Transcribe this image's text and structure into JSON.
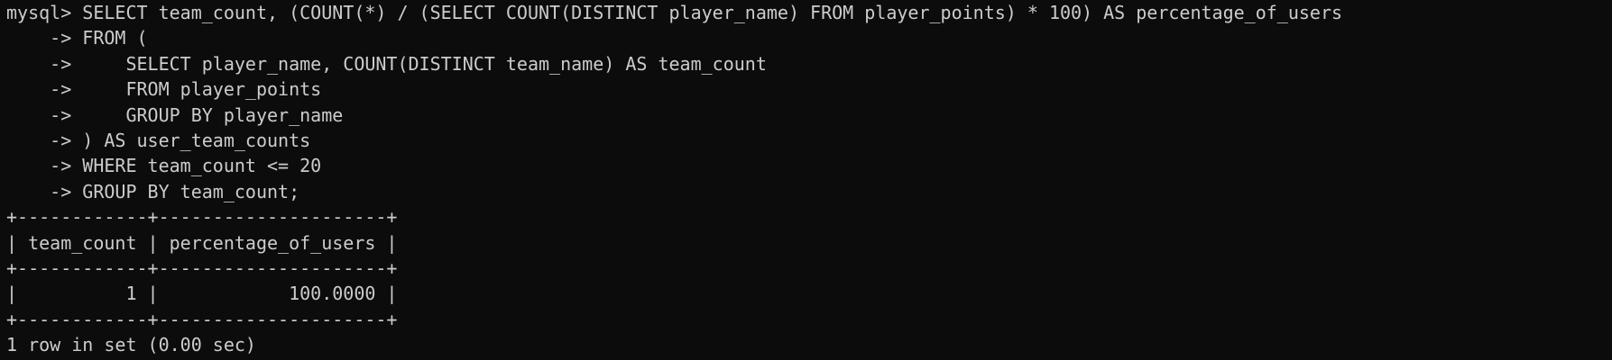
{
  "terminal": {
    "lines": [
      "mysql> SELECT team_count, (COUNT(*) / (SELECT COUNT(DISTINCT player_name) FROM player_points) * 100) AS percentage_of_users",
      "    -> FROM (",
      "    ->     SELECT player_name, COUNT(DISTINCT team_name) AS team_count",
      "    ->     FROM player_points",
      "    ->     GROUP BY player_name",
      "    -> ) AS user_team_counts",
      "    -> WHERE team_count <= 20",
      "    -> GROUP BY team_count;",
      "+------------+---------------------+",
      "| team_count | percentage_of_users |",
      "+------------+---------------------+",
      "|          1 |            100.0000 |",
      "+------------+---------------------+",
      "1 row in set (0.00 sec)"
    ]
  },
  "colors": {
    "background": "#0c0c0c",
    "text": "#cccccc"
  }
}
